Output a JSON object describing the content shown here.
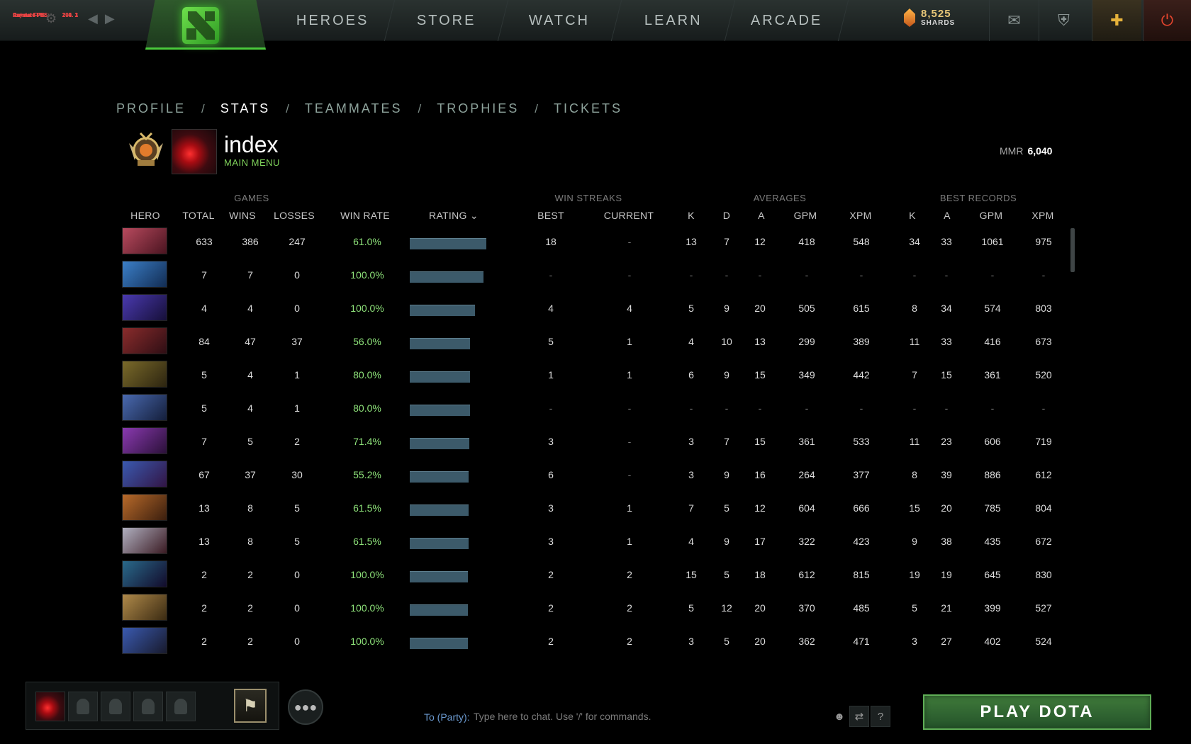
{
  "debug": {
    "rows": [
      [
        "Layout FPS:",
        "204. 1"
      ],
      [
        "Animate FPS:",
        "204. 1"
      ],
      [
        "Render FPS:",
        "199. 3"
      ]
    ]
  },
  "topnav": {
    "items": [
      "HEROES",
      "STORE",
      "WATCH",
      "LEARN",
      "ARCADE"
    ]
  },
  "shards": {
    "value": "8,525",
    "label": "SHARDS"
  },
  "subnav": {
    "tabs": [
      "PROFILE",
      "STATS",
      "TEAMMATES",
      "TROPHIES",
      "TICKETS"
    ],
    "active": "STATS",
    "separator": "/"
  },
  "profile": {
    "name": "index",
    "status": "MAIN MENU",
    "mmr_label": "MMR",
    "mmr_value": "6,040"
  },
  "table": {
    "groups": [
      "GAMES",
      "WIN STREAKS",
      "AVERAGES",
      "BEST RECORDS"
    ],
    "headers": [
      "HERO",
      "TOTAL",
      "WINS",
      "LOSSES",
      "WIN RATE",
      "RATING",
      "BEST",
      "CURRENT",
      "K",
      "D",
      "A",
      "GPM",
      "XPM",
      "K",
      "A",
      "GPM",
      "XPM"
    ],
    "rating_sort_icon": "chevron-down-icon",
    "rows": [
      {
        "hero": "red-horned-hero",
        "c": [
          "633",
          "386",
          "247",
          "61.0%",
          "18",
          "-",
          "13",
          "7",
          "12",
          "418",
          "548",
          "34",
          "33",
          "1061",
          "975"
        ],
        "rating": 1.0
      },
      {
        "hero": "blue-hero",
        "c": [
          "7",
          "7",
          "0",
          "100.0%",
          "-",
          "-",
          "-",
          "-",
          "-",
          "-",
          "-",
          "-",
          "-",
          "-",
          "-"
        ],
        "rating": 0.96
      },
      {
        "hero": "dark-blue-hero",
        "c": [
          "4",
          "4",
          "0",
          "100.0%",
          "4",
          "4",
          "5",
          "9",
          "20",
          "505",
          "615",
          "8",
          "34",
          "574",
          "803"
        ],
        "rating": 0.85
      },
      {
        "hero": "red-armored-hero",
        "c": [
          "84",
          "47",
          "37",
          "56.0%",
          "5",
          "1",
          "4",
          "10",
          "13",
          "299",
          "389",
          "11",
          "33",
          "416",
          "673"
        ],
        "rating": 0.79
      },
      {
        "hero": "gold-hero",
        "c": [
          "5",
          "4",
          "1",
          "80.0%",
          "1",
          "1",
          "6",
          "9",
          "15",
          "349",
          "442",
          "7",
          "15",
          "361",
          "520"
        ],
        "rating": 0.79
      },
      {
        "hero": "ghost-hero",
        "c": [
          "5",
          "4",
          "1",
          "80.0%",
          "-",
          "-",
          "-",
          "-",
          "-",
          "-",
          "-",
          "-",
          "-",
          "-",
          "-"
        ],
        "rating": 0.79
      },
      {
        "hero": "purple-hero",
        "c": [
          "7",
          "5",
          "2",
          "71.4%",
          "3",
          "-",
          "3",
          "7",
          "15",
          "361",
          "533",
          "11",
          "23",
          "606",
          "719"
        ],
        "rating": 0.78
      },
      {
        "hero": "winged-hero",
        "c": [
          "67",
          "37",
          "30",
          "55.2%",
          "6",
          "-",
          "3",
          "9",
          "16",
          "264",
          "377",
          "8",
          "39",
          "886",
          "612"
        ],
        "rating": 0.77
      },
      {
        "hero": "beast-hero",
        "c": [
          "13",
          "8",
          "5",
          "61.5%",
          "3",
          "1",
          "7",
          "5",
          "12",
          "604",
          "666",
          "15",
          "20",
          "785",
          "804"
        ],
        "rating": 0.77
      },
      {
        "hero": "pale-hero",
        "c": [
          "13",
          "8",
          "5",
          "61.5%",
          "3",
          "1",
          "4",
          "9",
          "17",
          "322",
          "423",
          "9",
          "38",
          "435",
          "672"
        ],
        "rating": 0.77
      },
      {
        "hero": "void-hero",
        "c": [
          "2",
          "2",
          "0",
          "100.0%",
          "2",
          "2",
          "15",
          "5",
          "18",
          "612",
          "815",
          "19",
          "19",
          "645",
          "830"
        ],
        "rating": 0.76
      },
      {
        "hero": "bearded-hero",
        "c": [
          "2",
          "2",
          "0",
          "100.0%",
          "2",
          "2",
          "5",
          "12",
          "20",
          "370",
          "485",
          "5",
          "21",
          "399",
          "527"
        ],
        "rating": 0.76
      },
      {
        "hero": "blue-armored-hero",
        "c": [
          "2",
          "2",
          "0",
          "100.0%",
          "2",
          "2",
          "3",
          "5",
          "20",
          "362",
          "471",
          "3",
          "27",
          "402",
          "524"
        ],
        "rating": 0.76
      }
    ]
  },
  "chat": {
    "label": "To (Party):",
    "placeholder": "Type here to chat. Use '/' for commands.",
    "help": "?"
  },
  "play_button": "PLAY DOTA",
  "colors": {
    "accent_green": "#4ac93c",
    "win_rate": "#8ee27a",
    "rating_bar": "#3c5a6a",
    "chat_label": "#6b9ad0"
  }
}
